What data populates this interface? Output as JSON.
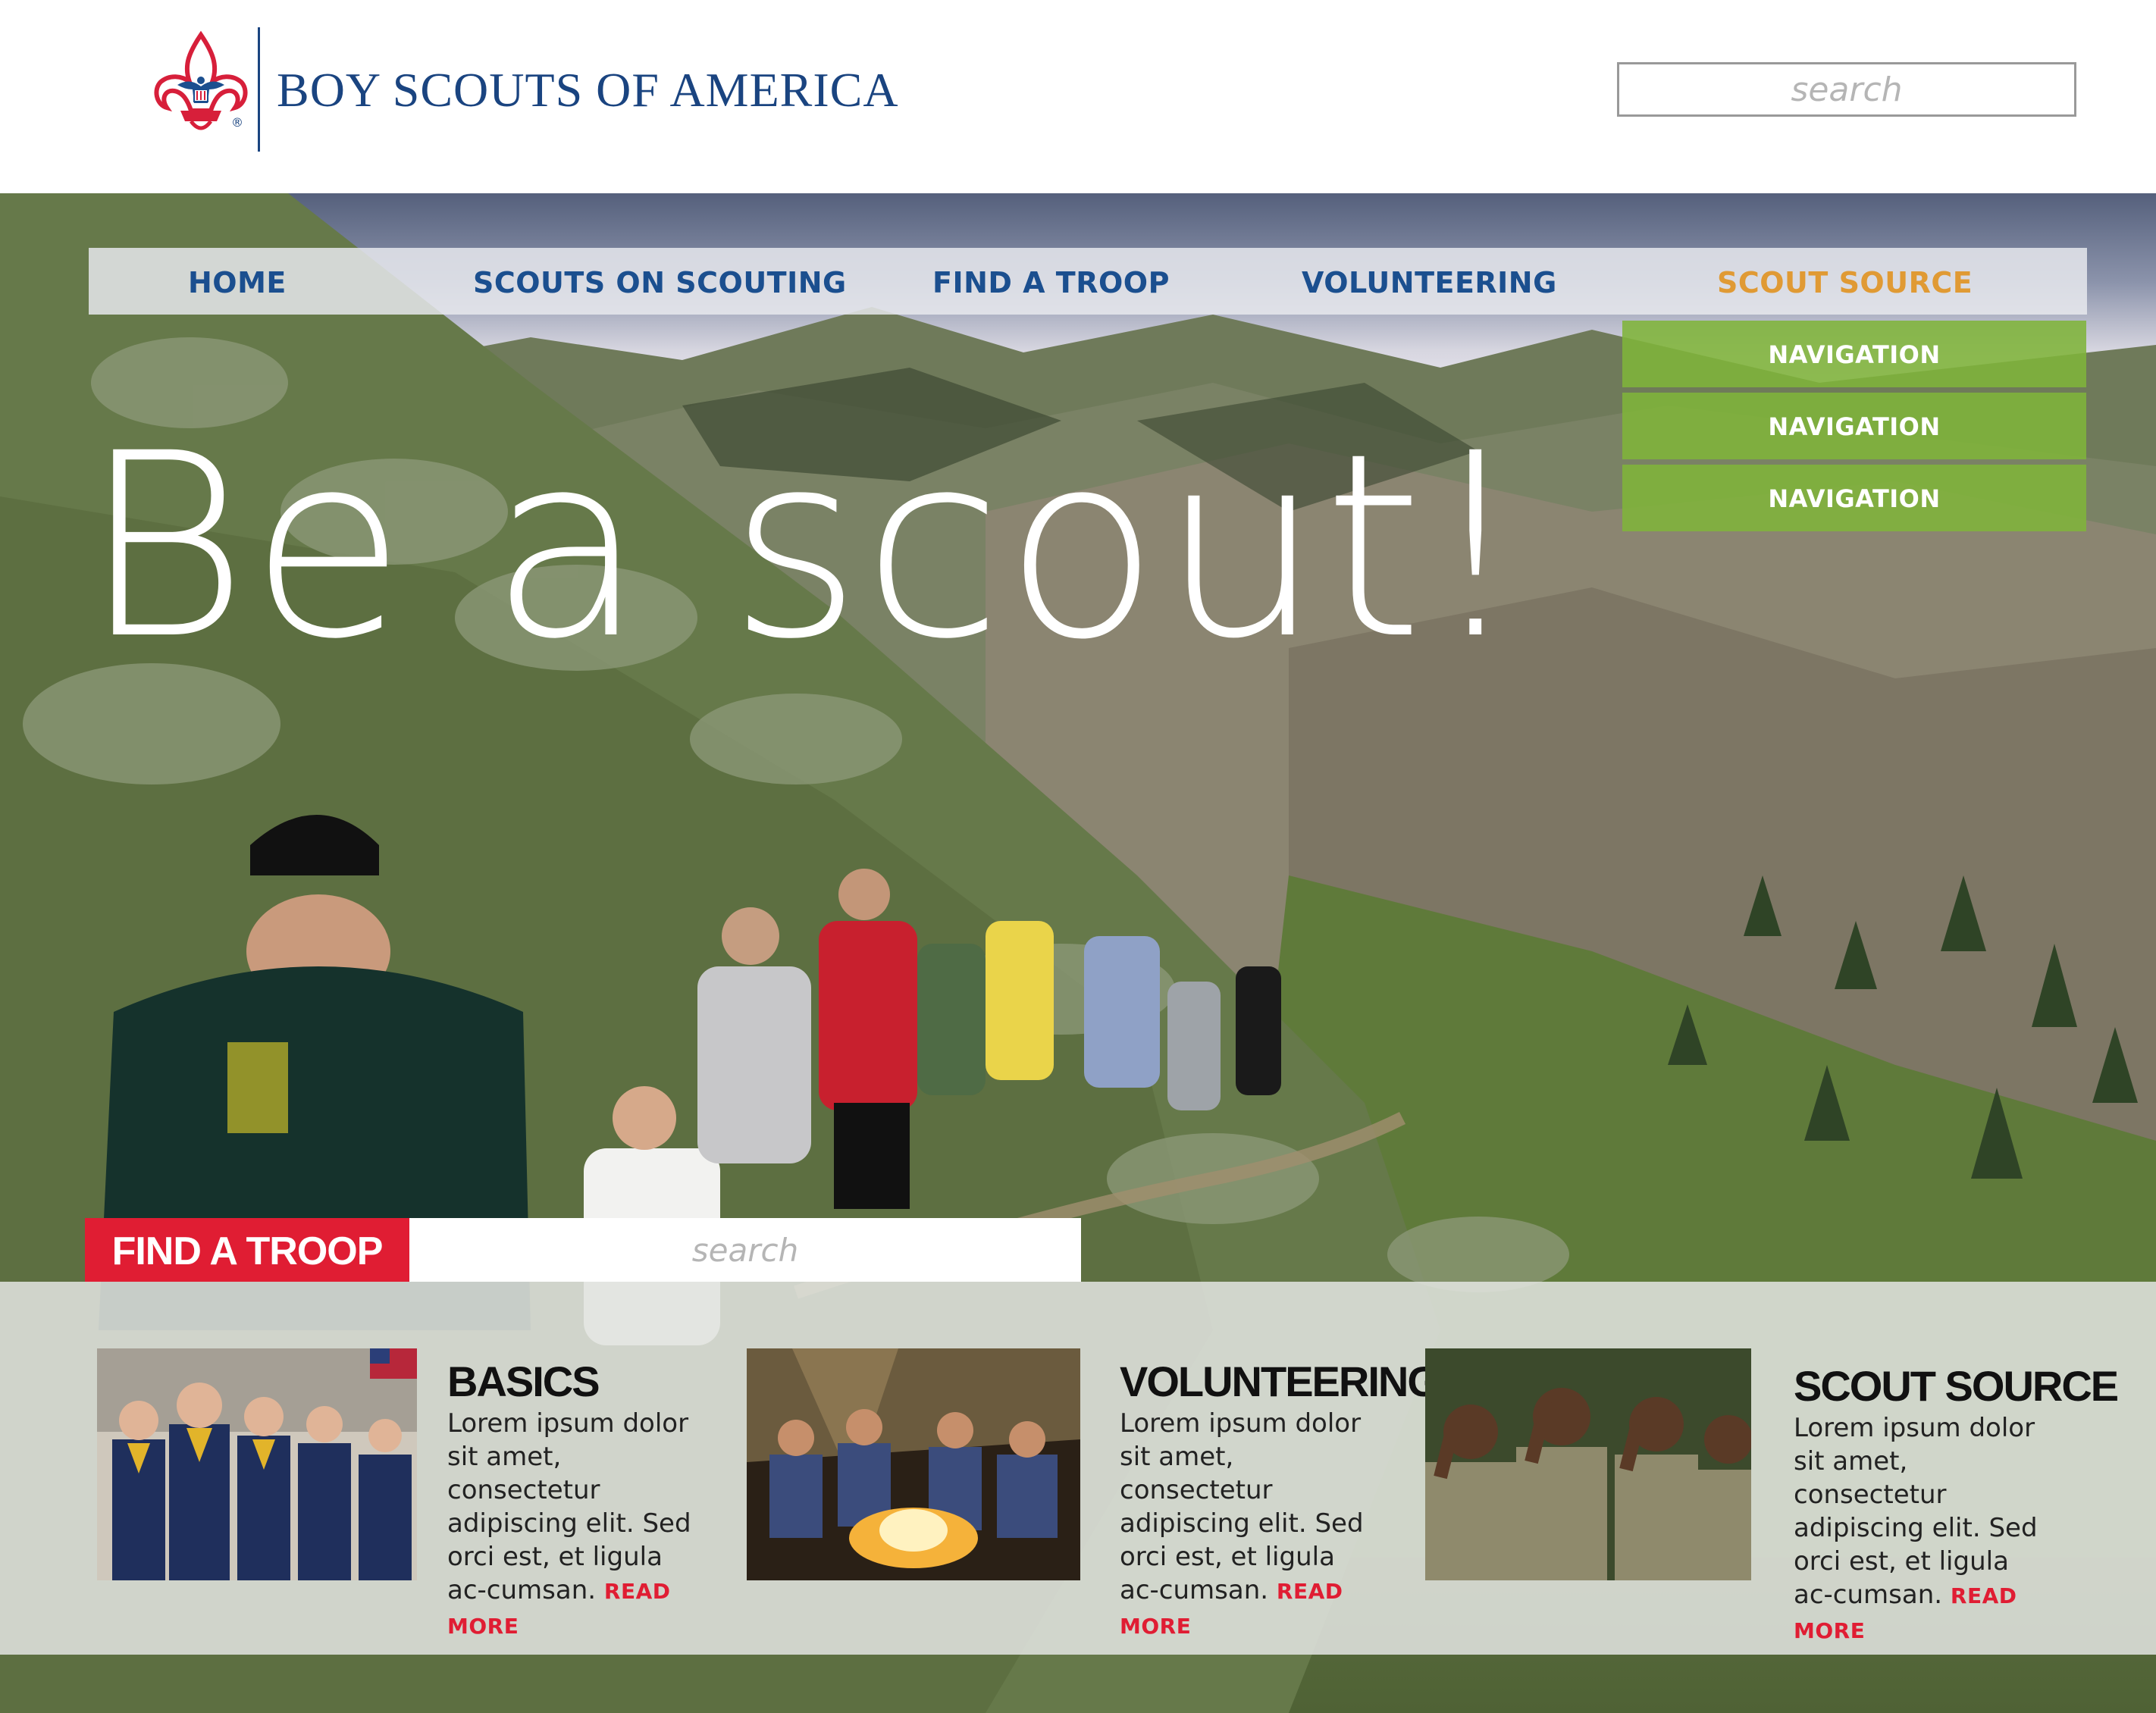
{
  "header": {
    "org_name": "BOY SCOUTS OF AMERICA",
    "trademark": "®",
    "search_placeholder": "search"
  },
  "nav": {
    "items": [
      {
        "label": "HOME"
      },
      {
        "label": "SCOUTS ON SCOUTING"
      },
      {
        "label": "FIND A TROOP"
      },
      {
        "label": "VOLUNTEERING"
      },
      {
        "label": "SCOUT SOURCE",
        "active": true
      }
    ],
    "dropdown": [
      "NAVIGATION",
      "NAVIGATION",
      "NAVIGATION"
    ]
  },
  "hero": {
    "headline": "Be a scout!"
  },
  "find_troop": {
    "label": "FIND A TROOP",
    "search_placeholder": "search"
  },
  "cards": [
    {
      "title": "BASICS",
      "body": "Lorem ipsum dolor sit amet, consectetur adipiscing elit. Sed orci est, et ligula ac-cumsan.",
      "link": "READ MORE"
    },
    {
      "title": "VOLUNTEERING",
      "body": "Lorem ipsum dolor sit amet, consectetur adipiscing elit. Sed orci est, et ligula ac-cumsan.",
      "link": "READ MORE"
    },
    {
      "title": "SCOUT SOURCE",
      "body": "Lorem ipsum dolor sit amet, consectetur adipiscing elit. Sed orci est, et ligula ac-cumsan.",
      "link": "READ MORE"
    }
  ],
  "colors": {
    "brand_blue": "#1b4f8f",
    "active_orange": "#e09a34",
    "dropdown_green": "#80b43a",
    "accent_red": "#e01d33"
  }
}
